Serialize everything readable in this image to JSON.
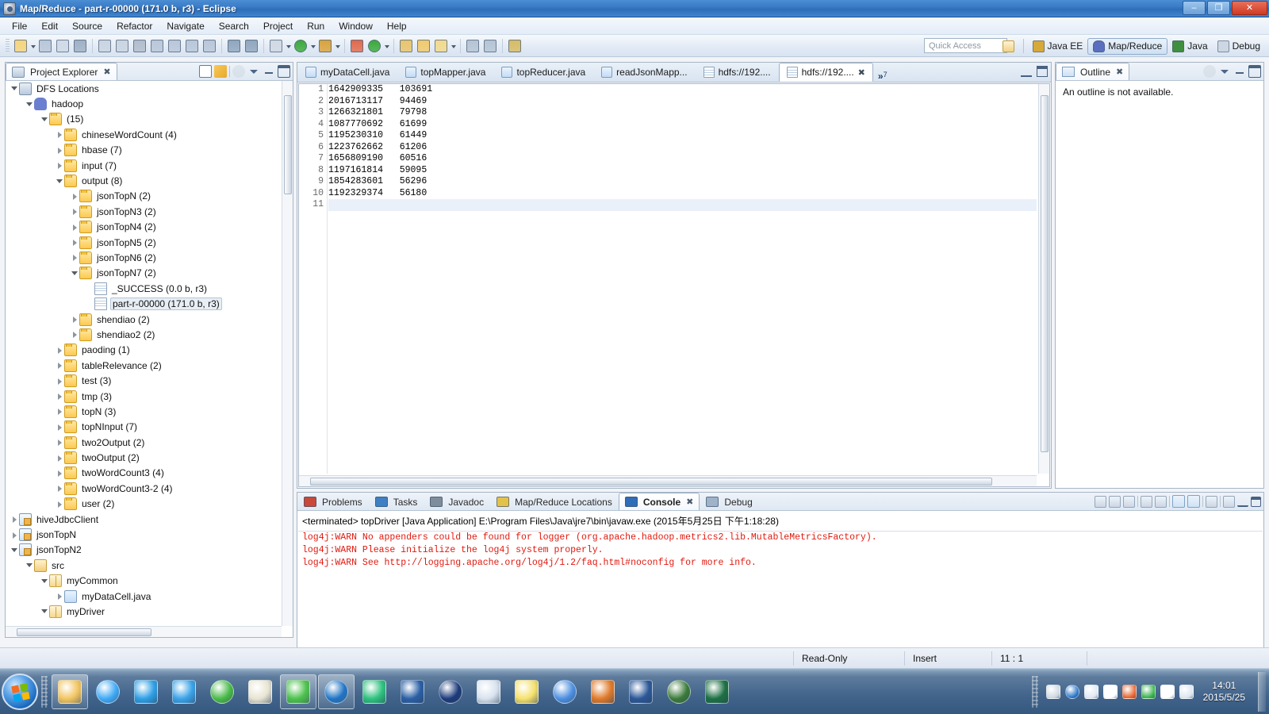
{
  "window": {
    "title": "Map/Reduce - part-r-00000 (171.0 b, r3) - Eclipse",
    "icon": "eclipse-icon",
    "minimize_label": "–",
    "maximize_label": "❐",
    "close_label": "✕"
  },
  "menubar": {
    "items": [
      "File",
      "Edit",
      "Source",
      "Refactor",
      "Navigate",
      "Search",
      "Project",
      "Run",
      "Window",
      "Help"
    ]
  },
  "toolbar": {
    "buttons": [
      {
        "name": "new-wizard-icon",
        "color": "#f6d47a",
        "arrow": true
      },
      {
        "name": "save-icon",
        "color": "#b8c6d8",
        "arrow": false
      },
      {
        "name": "save-all-icon",
        "color": "#cfd9e6",
        "arrow": false
      },
      {
        "name": "print-icon",
        "color": "#9fb0c4",
        "arrow": false
      },
      {
        "name": "resume-icon",
        "color": "#c9d4e1",
        "arrow": false
      },
      {
        "name": "suspend-icon",
        "color": "#c9d4e1",
        "arrow": false
      },
      {
        "name": "terminate-icon",
        "color": "#b0bccb",
        "arrow": false
      },
      {
        "name": "step-into-icon",
        "color": "#b8c6d8",
        "arrow": false
      },
      {
        "name": "step-over-icon",
        "color": "#b8c6d8",
        "arrow": false
      },
      {
        "name": "step-return-icon",
        "color": "#b8c6d8",
        "arrow": false
      },
      {
        "name": "drop-to-frame-icon",
        "color": "#b8c6d8",
        "arrow": false
      },
      {
        "name": "skip-breakpoints-icon",
        "color": "#8fa6bd",
        "arrow": false
      },
      {
        "name": "remove-breakpoints-icon",
        "color": "#8fa6bd",
        "arrow": false
      },
      {
        "name": "debug-icon",
        "color": "#cfd8e3",
        "arrow": true
      },
      {
        "name": "run-icon",
        "color": "#3aa93a",
        "arrow": true
      },
      {
        "name": "run-external-tools-icon",
        "color": "#d8a23a",
        "arrow": true
      },
      {
        "name": "new-java-package-icon",
        "color": "#e0694a",
        "arrow": false
      },
      {
        "name": "new-java-class-icon",
        "color": "#3aa93a",
        "arrow": true
      },
      {
        "name": "open-type-icon",
        "color": "#e8c46a",
        "arrow": false
      },
      {
        "name": "open-task-icon",
        "color": "#f0c96a",
        "arrow": false
      },
      {
        "name": "search-icon",
        "color": "#f2d98a",
        "arrow": true
      },
      {
        "name": "toggle-mark-occurrences-icon",
        "color": "#b4c3d3",
        "arrow": false
      },
      {
        "name": "toggle-block-selection-icon",
        "color": "#b4c3d3",
        "arrow": false
      },
      {
        "name": "next-annotation-icon",
        "color": "#d6bb62",
        "arrow": false
      }
    ],
    "quick_access_placeholder": "Quick Access"
  },
  "perspectives": {
    "open_perspective_label": "",
    "items": [
      {
        "label": "Java EE",
        "icon": "java-ee-perspective-icon",
        "active": false
      },
      {
        "label": "Map/Reduce",
        "icon": "map-reduce-perspective-icon",
        "active": true
      },
      {
        "label": "Java",
        "icon": "java-perspective-icon",
        "active": false
      },
      {
        "label": "Debug",
        "icon": "debug-perspective-icon",
        "active": false
      }
    ]
  },
  "project_explorer": {
    "tab_label": "Project Explorer",
    "tab_icon": "project-explorer-icon",
    "close_label": "✖",
    "tools": [
      "collapse-all-icon",
      "link-with-editor-icon",
      "focus-icon",
      "view-menu-icon",
      "minimize-icon",
      "maximize-icon"
    ],
    "tree": [
      {
        "label": "DFS Locations",
        "indent": 0,
        "arrow": "open",
        "icon": "dfs-locations-icon",
        "selected": false
      },
      {
        "label": "hadoop",
        "indent": 1,
        "arrow": "open",
        "icon": "hadoop-elephant-icon",
        "selected": false
      },
      {
        "label": "(15)",
        "indent": 2,
        "arrow": "open",
        "icon": "folder-icon",
        "selected": false
      },
      {
        "label": "chineseWordCount (4)",
        "indent": 3,
        "arrow": "closed",
        "icon": "folder-icon",
        "selected": false
      },
      {
        "label": "hbase (7)",
        "indent": 3,
        "arrow": "closed",
        "icon": "folder-icon",
        "selected": false
      },
      {
        "label": "input (7)",
        "indent": 3,
        "arrow": "closed",
        "icon": "folder-icon",
        "selected": false
      },
      {
        "label": "output (8)",
        "indent": 3,
        "arrow": "open",
        "icon": "folder-icon",
        "selected": false
      },
      {
        "label": "jsonTopN (2)",
        "indent": 4,
        "arrow": "closed",
        "icon": "folder-icon",
        "selected": false
      },
      {
        "label": "jsonTopN3 (2)",
        "indent": 4,
        "arrow": "closed",
        "icon": "folder-icon",
        "selected": false
      },
      {
        "label": "jsonTopN4 (2)",
        "indent": 4,
        "arrow": "closed",
        "icon": "folder-icon",
        "selected": false
      },
      {
        "label": "jsonTopN5 (2)",
        "indent": 4,
        "arrow": "closed",
        "icon": "folder-icon",
        "selected": false
      },
      {
        "label": "jsonTopN6 (2)",
        "indent": 4,
        "arrow": "closed",
        "icon": "folder-icon",
        "selected": false
      },
      {
        "label": "jsonTopN7 (2)",
        "indent": 4,
        "arrow": "open",
        "icon": "folder-icon",
        "selected": false
      },
      {
        "label": "_SUCCESS (0.0 b, r3)",
        "indent": 5,
        "arrow": "none",
        "icon": "file-icon",
        "selected": false
      },
      {
        "label": "part-r-00000 (171.0 b, r3)",
        "indent": 5,
        "arrow": "none",
        "icon": "file-icon",
        "selected": true
      },
      {
        "label": "shendiao (2)",
        "indent": 4,
        "arrow": "closed",
        "icon": "folder-icon",
        "selected": false
      },
      {
        "label": "shendiao2 (2)",
        "indent": 4,
        "arrow": "closed",
        "icon": "folder-icon",
        "selected": false
      },
      {
        "label": "paoding (1)",
        "indent": 3,
        "arrow": "closed",
        "icon": "folder-icon",
        "selected": false
      },
      {
        "label": "tableRelevance (2)",
        "indent": 3,
        "arrow": "closed",
        "icon": "folder-icon",
        "selected": false
      },
      {
        "label": "test (3)",
        "indent": 3,
        "arrow": "closed",
        "icon": "folder-icon",
        "selected": false
      },
      {
        "label": "tmp (3)",
        "indent": 3,
        "arrow": "closed",
        "icon": "folder-icon",
        "selected": false
      },
      {
        "label": "topN (3)",
        "indent": 3,
        "arrow": "closed",
        "icon": "folder-icon",
        "selected": false
      },
      {
        "label": "topNInput (7)",
        "indent": 3,
        "arrow": "closed",
        "icon": "folder-icon",
        "selected": false
      },
      {
        "label": "two2Output (2)",
        "indent": 3,
        "arrow": "closed",
        "icon": "folder-icon",
        "selected": false
      },
      {
        "label": "twoOutput (2)",
        "indent": 3,
        "arrow": "closed",
        "icon": "folder-icon",
        "selected": false
      },
      {
        "label": "twoWordCount3 (4)",
        "indent": 3,
        "arrow": "closed",
        "icon": "folder-icon",
        "selected": false
      },
      {
        "label": "twoWordCount3-2 (4)",
        "indent": 3,
        "arrow": "closed",
        "icon": "folder-icon",
        "selected": false
      },
      {
        "label": "user (2)",
        "indent": 3,
        "arrow": "closed",
        "icon": "folder-icon",
        "selected": false
      },
      {
        "label": "hiveJdbcClient",
        "indent": 0,
        "arrow": "closed",
        "icon": "java-project-icon",
        "selected": false
      },
      {
        "label": "jsonTopN",
        "indent": 0,
        "arrow": "closed",
        "icon": "java-project-icon",
        "selected": false
      },
      {
        "label": "jsonTopN2",
        "indent": 0,
        "arrow": "open",
        "icon": "java-project-icon",
        "selected": false
      },
      {
        "label": "src",
        "indent": 1,
        "arrow": "open",
        "icon": "source-folder-icon",
        "selected": false
      },
      {
        "label": "myCommon",
        "indent": 2,
        "arrow": "open",
        "icon": "package-icon",
        "selected": false
      },
      {
        "label": "myDataCell.java",
        "indent": 3,
        "arrow": "closed",
        "icon": "java-file-icon",
        "selected": false
      },
      {
        "label": "myDriver",
        "indent": 2,
        "arrow": "open",
        "icon": "package-icon",
        "selected": false
      }
    ]
  },
  "editor": {
    "tabs": [
      {
        "label": "myDataCell.java",
        "icon": "java-file-icon",
        "active": false
      },
      {
        "label": "topMapper.java",
        "icon": "java-file-icon",
        "active": false
      },
      {
        "label": "topReducer.java",
        "icon": "java-file-icon",
        "active": false
      },
      {
        "label": "readJsonMapp...",
        "icon": "java-file-icon",
        "active": false
      },
      {
        "label": "hdfs://192....",
        "icon": "text-file-icon",
        "active": false
      },
      {
        "label": "hdfs://192....",
        "icon": "text-file-icon",
        "active": true
      }
    ],
    "overflow_label": "»",
    "overflow_count": "7",
    "close_label": "✖",
    "minimize_label": "–",
    "maximize_label": "❐",
    "content": {
      "lines": [
        {
          "n": "1",
          "text": "1642909335   103691"
        },
        {
          "n": "2",
          "text": "2016713117   94469"
        },
        {
          "n": "3",
          "text": "1266321801   79798"
        },
        {
          "n": "4",
          "text": "1087770692   61699"
        },
        {
          "n": "5",
          "text": "1195230310   61449"
        },
        {
          "n": "6",
          "text": "1223762662   61206"
        },
        {
          "n": "7",
          "text": "1656809190   60516"
        },
        {
          "n": "8",
          "text": "1197161814   59095"
        },
        {
          "n": "9",
          "text": "1854283601   56296"
        },
        {
          "n": "10",
          "text": "1192329374   56180"
        },
        {
          "n": "11",
          "text": ""
        }
      ],
      "current_line": 11
    }
  },
  "outline": {
    "tab_label": "Outline",
    "tab_icon": "outline-icon",
    "close_label": "✖",
    "message": "An outline is not available.",
    "tools": [
      "focus-icon",
      "view-menu-icon",
      "minimize-icon",
      "maximize-icon"
    ]
  },
  "console": {
    "tabs": [
      {
        "label": "Problems",
        "icon": "problems-icon",
        "active": false
      },
      {
        "label": "Tasks",
        "icon": "tasks-icon",
        "active": false
      },
      {
        "label": "Javadoc",
        "icon": "javadoc-icon",
        "active": false
      },
      {
        "label": "Map/Reduce Locations",
        "icon": "map-reduce-locations-icon",
        "active": false
      },
      {
        "label": "Console",
        "icon": "console-icon",
        "active": true
      },
      {
        "label": "Debug",
        "icon": "debug-icon",
        "active": false
      }
    ],
    "close_label": "✖",
    "header": "<terminated> topDriver [Java Application] E:\\Program Files\\Java\\jre7\\bin\\javaw.exe (2015年5月25日 下午1:18:28)",
    "lines": [
      "log4j:WARN No appenders could be found for logger (org.apache.hadoop.metrics2.lib.MutableMetricsFactory).",
      "log4j:WARN Please initialize the log4j system properly.",
      "log4j:WARN See http://logging.apache.org/log4j/1.2/faq.html#noconfig for more info."
    ],
    "text_color": "#e2180e",
    "tools": [
      "clear-console-icon",
      "terminate-icon",
      "remove-all-terminated-icon",
      "scroll-lock-icon",
      "word-wrap-icon",
      "show-console-on-output-icon",
      "pin-console-icon",
      "display-selected-console-icon",
      "open-console-icon",
      "minimize-icon",
      "maximize-icon"
    ]
  },
  "statusbar": {
    "read_only": "Read-Only",
    "insert_mode": "Insert",
    "cursor_position": "11 : 1"
  },
  "taskbar": {
    "start_label": "start",
    "buttons": [
      {
        "name": "taskbar-file-explorer",
        "color": "#f2c560"
      },
      {
        "name": "taskbar-internet-explorer",
        "color": "#3fa9f5"
      },
      {
        "name": "taskbar-qq",
        "color": "#2e9fe5"
      },
      {
        "name": "taskbar-weibo",
        "color": "#3aa3e8"
      },
      {
        "name": "taskbar-360-safe",
        "color": "#48b948"
      },
      {
        "name": "taskbar-notepad-editor",
        "color": "#e8e4d2"
      },
      {
        "name": "taskbar-browser-green",
        "color": "#4cc24c"
      },
      {
        "name": "taskbar-media-player",
        "color": "#1f74c4"
      },
      {
        "name": "taskbar-sogou",
        "color": "#2ec27e"
      },
      {
        "name": "taskbar-video-app",
        "color": "#2a5fa5"
      },
      {
        "name": "taskbar-navicat",
        "color": "#1b3a7a"
      },
      {
        "name": "taskbar-database-tool",
        "color": "#d8e2ee"
      },
      {
        "name": "taskbar-notes-app",
        "color": "#f5e16c"
      },
      {
        "name": "taskbar-chrome",
        "color": "#4b8ee0"
      },
      {
        "name": "taskbar-java-app",
        "color": "#e07a2a"
      },
      {
        "name": "taskbar-word",
        "color": "#2b5797"
      },
      {
        "name": "taskbar-hummingbird",
        "color": "#3a7a3a"
      },
      {
        "name": "taskbar-excel",
        "color": "#1d7044"
      }
    ],
    "tray": [
      {
        "name": "tray-keyboard-icon",
        "color": "#cfd8e2"
      },
      {
        "name": "tray-help-icon",
        "color": "#1f6fc4"
      },
      {
        "name": "tray-show-hidden-icon",
        "color": "#dfe8f2"
      },
      {
        "name": "tray-volume-icon",
        "color": "#ffffff"
      },
      {
        "name": "tray-antivirus-icon",
        "color": "#e8622a"
      },
      {
        "name": "tray-network-icon",
        "color": "#35b24a"
      },
      {
        "name": "tray-input-method-icon",
        "color": "#ffffff"
      },
      {
        "name": "tray-monitor-icon",
        "color": "#dce6f0"
      }
    ],
    "clock_time": "14:01",
    "clock_date": "2015/5/25"
  }
}
